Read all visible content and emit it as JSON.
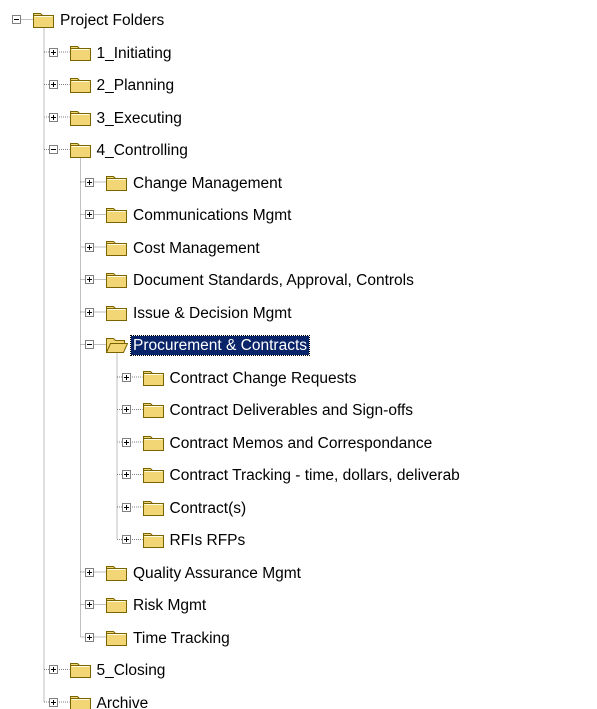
{
  "tree": {
    "nodes": [
      {
        "label": "Project Folders",
        "level": 0,
        "expanded": true,
        "selected": false,
        "icon": "folder-icon"
      },
      {
        "label": "1_Initiating",
        "level": 1,
        "expanded": false,
        "selected": false,
        "icon": "folder-icon"
      },
      {
        "label": "2_Planning",
        "level": 1,
        "expanded": false,
        "selected": false,
        "icon": "folder-icon"
      },
      {
        "label": "3_Executing",
        "level": 1,
        "expanded": false,
        "selected": false,
        "icon": "folder-icon"
      },
      {
        "label": "4_Controlling",
        "level": 1,
        "expanded": true,
        "selected": false,
        "icon": "folder-icon"
      },
      {
        "label": "Change Management",
        "level": 2,
        "expanded": false,
        "selected": false,
        "icon": "folder-icon"
      },
      {
        "label": "Communications Mgmt",
        "level": 2,
        "expanded": false,
        "selected": false,
        "icon": "folder-icon"
      },
      {
        "label": "Cost Management",
        "level": 2,
        "expanded": false,
        "selected": false,
        "icon": "folder-icon"
      },
      {
        "label": "Document Standards, Approval, Controls",
        "level": 2,
        "expanded": false,
        "selected": false,
        "icon": "folder-icon"
      },
      {
        "label": "Issue & Decision Mgmt",
        "level": 2,
        "expanded": false,
        "selected": false,
        "icon": "folder-icon"
      },
      {
        "label": "Procurement & Contracts",
        "level": 2,
        "expanded": true,
        "selected": true,
        "icon": "open-folder-icon"
      },
      {
        "label": "Contract Change Requests",
        "level": 3,
        "expanded": false,
        "selected": false,
        "icon": "folder-icon"
      },
      {
        "label": "Contract Deliverables and Sign-offs",
        "level": 3,
        "expanded": false,
        "selected": false,
        "icon": "folder-icon"
      },
      {
        "label": "Contract Memos and Correspondance",
        "level": 3,
        "expanded": false,
        "selected": false,
        "icon": "folder-icon"
      },
      {
        "label": "Contract Tracking - time, dollars, deliverab",
        "level": 3,
        "expanded": false,
        "selected": false,
        "icon": "folder-icon"
      },
      {
        "label": "Contract(s)",
        "level": 3,
        "expanded": false,
        "selected": false,
        "icon": "folder-icon"
      },
      {
        "label": "RFIs RFPs",
        "level": 3,
        "expanded": false,
        "selected": false,
        "icon": "folder-icon"
      },
      {
        "label": "Quality Assurance Mgmt",
        "level": 2,
        "expanded": false,
        "selected": false,
        "icon": "folder-icon"
      },
      {
        "label": "Risk Mgmt",
        "level": 2,
        "expanded": false,
        "selected": false,
        "icon": "folder-icon"
      },
      {
        "label": "Time Tracking",
        "level": 2,
        "expanded": false,
        "selected": false,
        "icon": "folder-icon"
      },
      {
        "label": "5_Closing",
        "level": 1,
        "expanded": false,
        "selected": false,
        "icon": "folder-icon"
      },
      {
        "label": "Archive",
        "level": 1,
        "expanded": false,
        "selected": false,
        "icon": "folder-icon"
      }
    ]
  },
  "colors": {
    "selection_background": "#0a246a",
    "selection_text": "#ffffff",
    "folder_fill": "#f2d675",
    "folder_stroke": "#7a6400",
    "connector_lines": "#808080"
  }
}
